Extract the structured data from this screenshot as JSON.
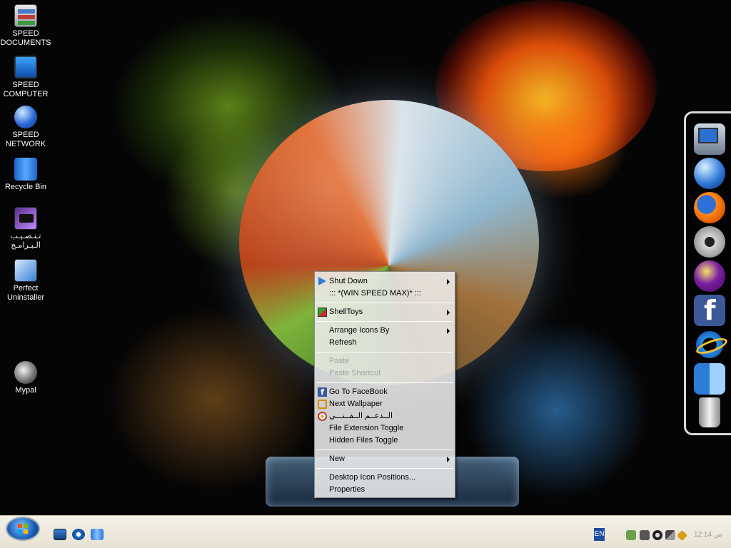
{
  "desktop_icons": [
    {
      "name": "speed-documents",
      "label": "SPEED\nDOCUMENTS",
      "icon": "documents-icon"
    },
    {
      "name": "speed-computer",
      "label": "SPEED\nCOMPUTER",
      "icon": "computer-icon"
    },
    {
      "name": "speed-network",
      "label": "SPEED\nNETWORK",
      "icon": "network-globe-icon"
    },
    {
      "name": "recycle-bin",
      "label": "Recycle Bin",
      "icon": "recycle-bin-icon"
    },
    {
      "name": "install-programs",
      "label": "تـنـصـيـب\nالـبـرامـج",
      "icon": "installer-icon"
    },
    {
      "name": "perfect-uninstaller",
      "label": "Perfect\nUninstaller",
      "icon": "uninstaller-icon"
    },
    {
      "name": "mypal",
      "label": "Mypal",
      "icon": "mypal-icon"
    }
  ],
  "context_menu": {
    "items": [
      {
        "label": "Shut Down",
        "icon": "shutdown-icon",
        "submenu": true,
        "disabled": false
      },
      {
        "label": "::: *(WIN SPEED MAX)* :::",
        "submenu": false,
        "disabled": false
      },
      {
        "label": "ShellToys",
        "icon": "shelltoys-icon",
        "submenu": true,
        "disabled": false
      },
      {
        "label": "Arrange Icons By",
        "submenu": true,
        "disabled": false
      },
      {
        "label": "Refresh",
        "submenu": false,
        "disabled": false
      },
      {
        "label": "Paste",
        "submenu": false,
        "disabled": true
      },
      {
        "label": "Paste Shortcut",
        "submenu": false,
        "disabled": true
      },
      {
        "label": "Go To FaceBook",
        "icon": "facebook-icon",
        "submenu": false,
        "disabled": false
      },
      {
        "label": "Next Wallpaper",
        "icon": "next-arrow-icon",
        "submenu": false,
        "disabled": false
      },
      {
        "label": "الــدعــم الــفــنـــي",
        "icon": "support-lifebuoy-icon",
        "submenu": false,
        "disabled": false
      },
      {
        "label": "File Extension Toggle",
        "submenu": false,
        "disabled": false
      },
      {
        "label": "Hidden Files Toggle",
        "submenu": false,
        "disabled": false
      },
      {
        "label": "New",
        "submenu": true,
        "disabled": false
      },
      {
        "label": "Desktop Icon Positions...",
        "submenu": false,
        "disabled": false
      },
      {
        "label": "Properties",
        "submenu": false,
        "disabled": false
      }
    ]
  },
  "dock": {
    "items": [
      "computer-icon",
      "globe-icon",
      "firefox-icon",
      "settings-gear-icon",
      "yahoo-messenger-icon",
      "facebook-icon",
      "internet-explorer-icon",
      "finder-icon",
      "trash-icon"
    ]
  },
  "taskbar": {
    "quick_launch": [
      "show-desktop-icon",
      "internet-explorer-icon",
      "recycle-bin-icon"
    ],
    "language": "EN",
    "clock": "12:14 ص"
  }
}
